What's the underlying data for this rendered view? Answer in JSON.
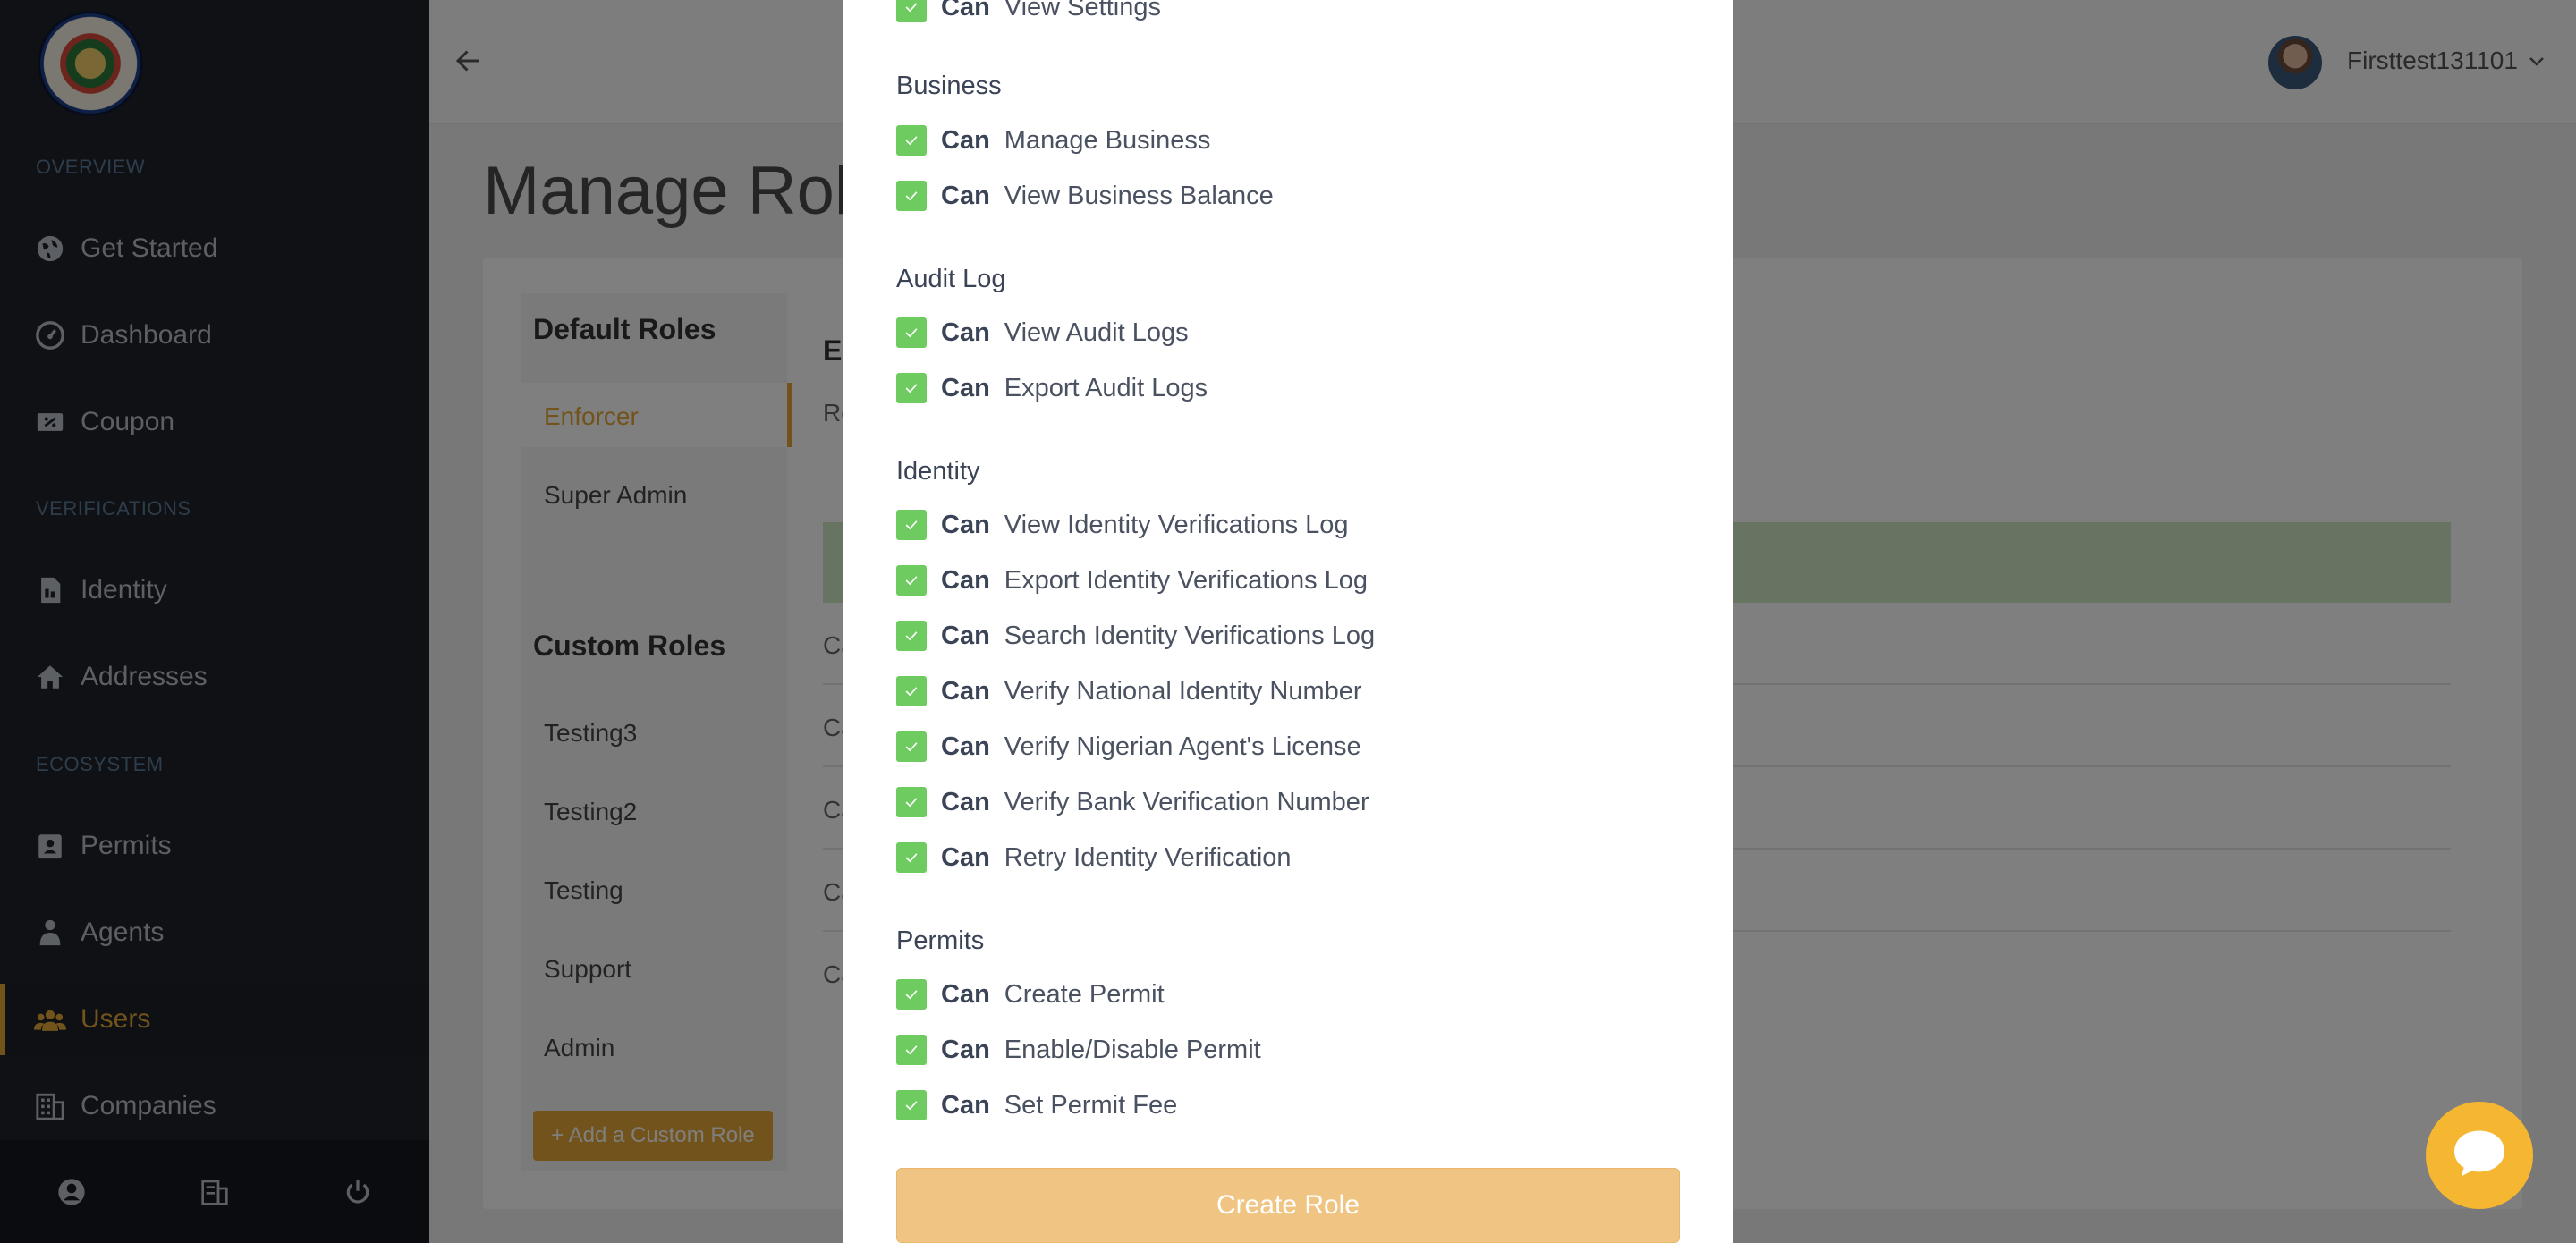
{
  "sidebar": {
    "sections": {
      "overview": "OVERVIEW",
      "verifications": "VERIFICATIONS",
      "ecosystem": "ECOSYSTEM"
    },
    "items": [
      {
        "label": "Get Started",
        "icon": "globe-icon"
      },
      {
        "label": "Dashboard",
        "icon": "gauge-icon"
      },
      {
        "label": "Coupon",
        "icon": "ticket-icon"
      },
      {
        "label": "Identity",
        "icon": "document-icon"
      },
      {
        "label": "Addresses",
        "icon": "home-icon"
      },
      {
        "label": "Permits",
        "icon": "badge-icon"
      },
      {
        "label": "Agents",
        "icon": "agent-icon"
      },
      {
        "label": "Users",
        "icon": "users-icon",
        "active": true
      },
      {
        "label": "Companies",
        "icon": "building-icon"
      }
    ],
    "footer_icons": [
      "user-circle-icon",
      "building-icon",
      "power-icon"
    ]
  },
  "header": {
    "username": "Firsttest131101"
  },
  "page": {
    "title": "Manage Role",
    "default_roles_heading": "Default Roles",
    "default_roles": [
      "Enforcer",
      "Super Admin"
    ],
    "custom_roles_heading": "Custom Roles",
    "custom_roles": [
      "Testing3",
      "Testing2",
      "Testing",
      "Support",
      "Admin"
    ],
    "add_custom_role": "+ Add a Custom Role",
    "detail_fragments": {
      "heading": "E",
      "sub": "Ro",
      "rows": [
        "Ca",
        "Ca",
        "Ca",
        "Ca",
        "Ca"
      ]
    }
  },
  "modal": {
    "can_label": "Can",
    "top_row": "View Settings",
    "groups": [
      {
        "title": "Business",
        "permissions": [
          "Manage Business",
          "View Business Balance"
        ]
      },
      {
        "title": "Audit Log",
        "permissions": [
          "View Audit Logs",
          "Export Audit Logs"
        ]
      },
      {
        "title": "Identity",
        "permissions": [
          "View Identity Verifications Log",
          "Export Identity Verifications Log",
          "Search Identity Verifications Log",
          "Verify National Identity Number",
          "Verify Nigerian Agent's License",
          "Verify Bank Verification Number",
          "Retry Identity Verification"
        ]
      },
      {
        "title": "Permits",
        "permissions": [
          "Create Permit",
          "Enable/Disable Permit",
          "Set Permit Fee"
        ]
      }
    ],
    "submit_label": "Create Role"
  },
  "colors": {
    "accent": "#e3a636",
    "sidebar_bg": "#1f232b",
    "checkbox": "#6dcb5f",
    "chat": "#f5b731"
  }
}
